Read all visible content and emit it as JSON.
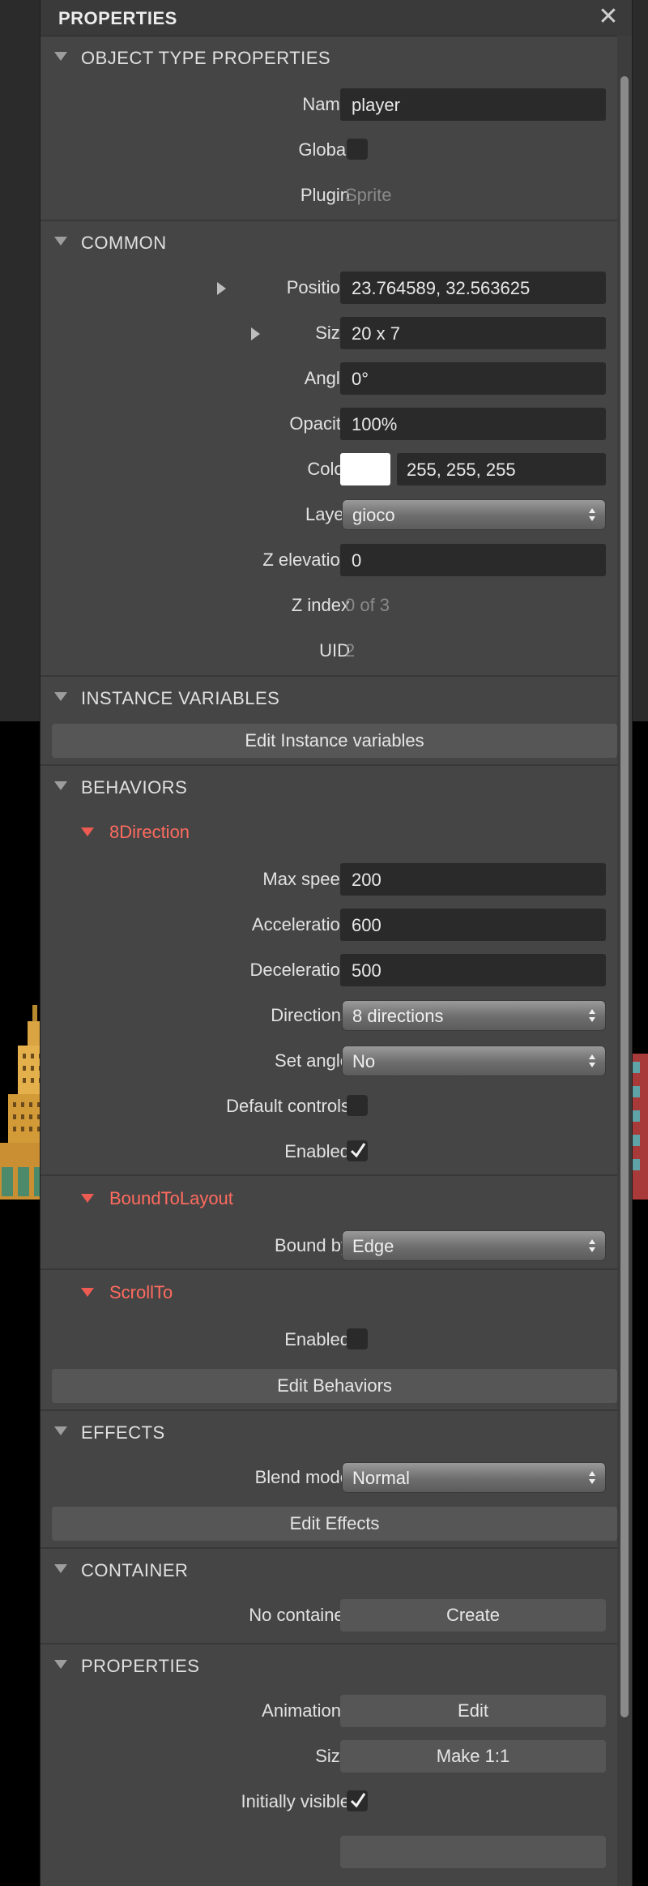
{
  "panel": {
    "title": "PROPERTIES"
  },
  "object_type": {
    "header": "OBJECT TYPE PROPERTIES",
    "name_label": "Name",
    "name_value": "player",
    "global_label": "Global",
    "global_checked": false,
    "plugin_label": "Plugin",
    "plugin_value": "Sprite"
  },
  "common": {
    "header": "COMMON",
    "position_label": "Position",
    "position_value": "23.764589, 32.563625",
    "size_label": "Size",
    "size_value": "20 x 7",
    "angle_label": "Angle",
    "angle_value": "0°",
    "opacity_label": "Opacity",
    "opacity_value": "100%",
    "color_label": "Color",
    "color_value": "255, 255, 255",
    "color_swatch": "#ffffff",
    "layer_label": "Layer",
    "layer_value": "gioco",
    "z_elevation_label": "Z elevation",
    "z_elevation_value": "0",
    "z_index_label": "Z index",
    "z_index_value": "0 of 3",
    "uid_label": "UID",
    "uid_value": "2"
  },
  "instance_variables": {
    "header": "INSTANCE VARIABLES",
    "edit_button": "Edit Instance variables"
  },
  "behaviors": {
    "header": "BEHAVIORS",
    "eight_direction": {
      "name": "8Direction",
      "max_speed_label": "Max speed",
      "max_speed_value": "200",
      "acceleration_label": "Acceleration",
      "acceleration_value": "600",
      "deceleration_label": "Deceleration",
      "deceleration_value": "500",
      "directions_label": "Directions",
      "directions_value": "8 directions",
      "set_angle_label": "Set angle",
      "set_angle_value": "No",
      "default_controls_label": "Default controls",
      "default_controls_checked": false,
      "enabled_label": "Enabled",
      "enabled_checked": true
    },
    "bound_to_layout": {
      "name": "BoundToLayout",
      "bound_by_label": "Bound by",
      "bound_by_value": "Edge"
    },
    "scroll_to": {
      "name": "ScrollTo",
      "enabled_label": "Enabled",
      "enabled_checked": false
    },
    "edit_button": "Edit Behaviors"
  },
  "effects": {
    "header": "EFFECTS",
    "blend_mode_label": "Blend mode",
    "blend_mode_value": "Normal",
    "edit_button": "Edit Effects"
  },
  "container": {
    "header": "CONTAINER",
    "no_container_label": "No container",
    "create_button": "Create"
  },
  "properties": {
    "header": "PROPERTIES",
    "animations_label": "Animations",
    "animations_button": "Edit",
    "size_label": "Size",
    "size_button": "Make 1:1",
    "initially_visible_label": "Initially visible",
    "initially_visible_checked": true
  },
  "colors": {
    "panel_bg": "#454545",
    "field_bg": "#2a2a2a",
    "behavior_name": "#ff6b5f",
    "button_bg": "#565656"
  }
}
